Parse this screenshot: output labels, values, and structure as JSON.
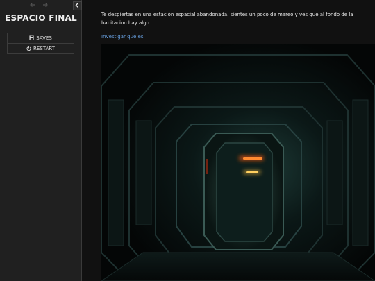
{
  "sidebar": {
    "title": "ESPACIO FINAL",
    "back_icon": "arrow-left-icon",
    "forward_icon": "arrow-right-icon",
    "toggle_icon": "chevron-left-icon",
    "menu": [
      {
        "label": "SAVES",
        "icon": "floppy-disk-icon"
      },
      {
        "label": "RESTART",
        "icon": "power-icon"
      }
    ]
  },
  "passage": {
    "text": "Te despiertas en una estación espacial abandonada. sientes un poco de mareo y ves que al fondo de la habitacion hay algo...",
    "link": "Investigar que es"
  },
  "colors": {
    "background": "#111111",
    "sidebar": "#202020",
    "link": "#68a0e0",
    "light_orange": "#ff6a20",
    "light_yellow": "#ffc040"
  }
}
